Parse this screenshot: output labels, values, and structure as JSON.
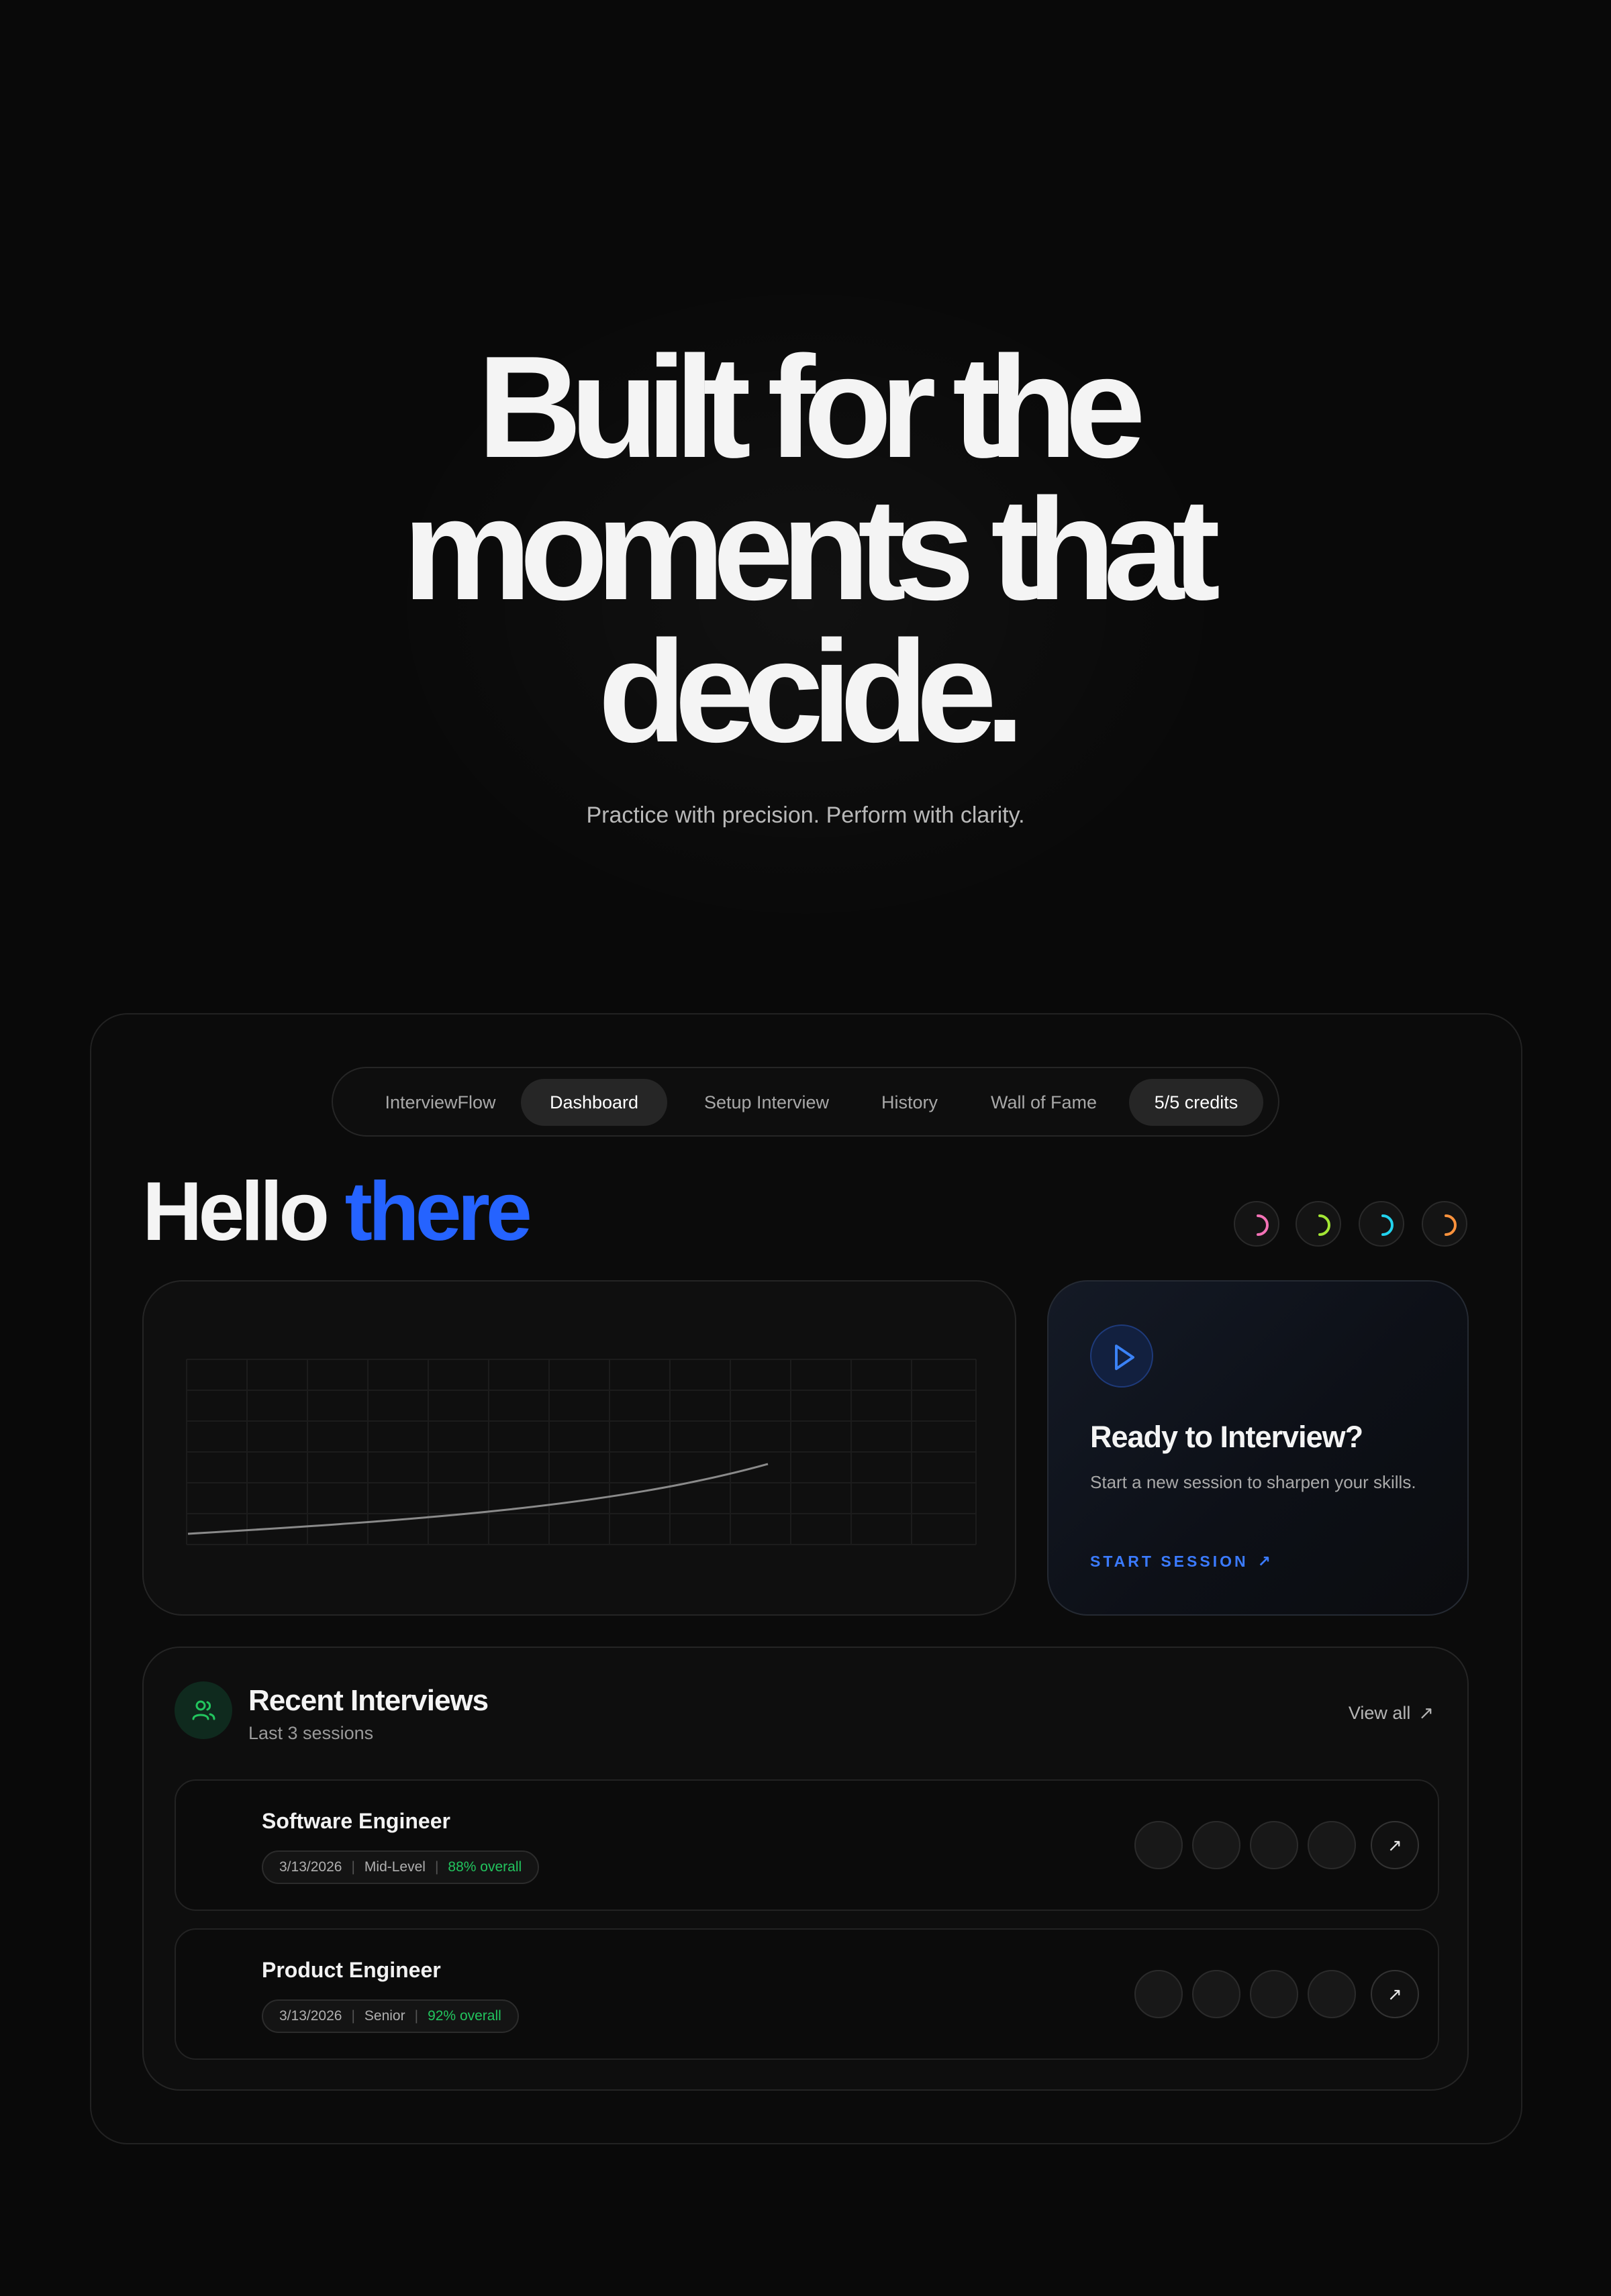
{
  "hero": {
    "title_lines": [
      "Built for the",
      "moments that",
      "decide."
    ],
    "subtitle": "Practice with precision. Perform with clarity."
  },
  "nav": {
    "items": [
      {
        "label": "InterviewFlow",
        "state": "default"
      },
      {
        "label": "Dashboard",
        "state": "active"
      },
      {
        "label": "Setup Interview",
        "state": "default"
      },
      {
        "label": "History",
        "state": "default"
      },
      {
        "label": "Wall of Fame",
        "state": "default"
      },
      {
        "label": "5/5 credits",
        "state": "badge"
      }
    ]
  },
  "greeting": {
    "prefix": "Hello",
    "accent": "there"
  },
  "progress_rings": [
    {
      "icon": "spinner-ring-icon",
      "color": "#f472b6"
    },
    {
      "icon": "spinner-ring-icon",
      "color": "#a3e635"
    },
    {
      "icon": "spinner-ring-icon",
      "color": "#22d3ee"
    },
    {
      "icon": "spinner-ring-icon",
      "color": "#fb923c"
    }
  ],
  "cta": {
    "icon": "play-icon",
    "title": "Ready to Interview?",
    "description": "Start a new session to sharpen your skills.",
    "link_label": "START SESSION",
    "link_icon": "arrow-up-right-icon"
  },
  "recent": {
    "icon": "users-icon",
    "title": "Recent Interviews",
    "subtitle": "Last 3 sessions",
    "view_all": "View all",
    "rows": [
      {
        "title": "Software Engineer",
        "date": "3/13/2026",
        "level": "Mid-Level",
        "score": "88% overall"
      },
      {
        "title": "Product Engineer",
        "date": "3/13/2026",
        "level": "Senior",
        "score": "92% overall"
      }
    ]
  },
  "colors": {
    "accent_blue": "#2563ff",
    "score_green": "#22c55e",
    "background": "#090909"
  }
}
